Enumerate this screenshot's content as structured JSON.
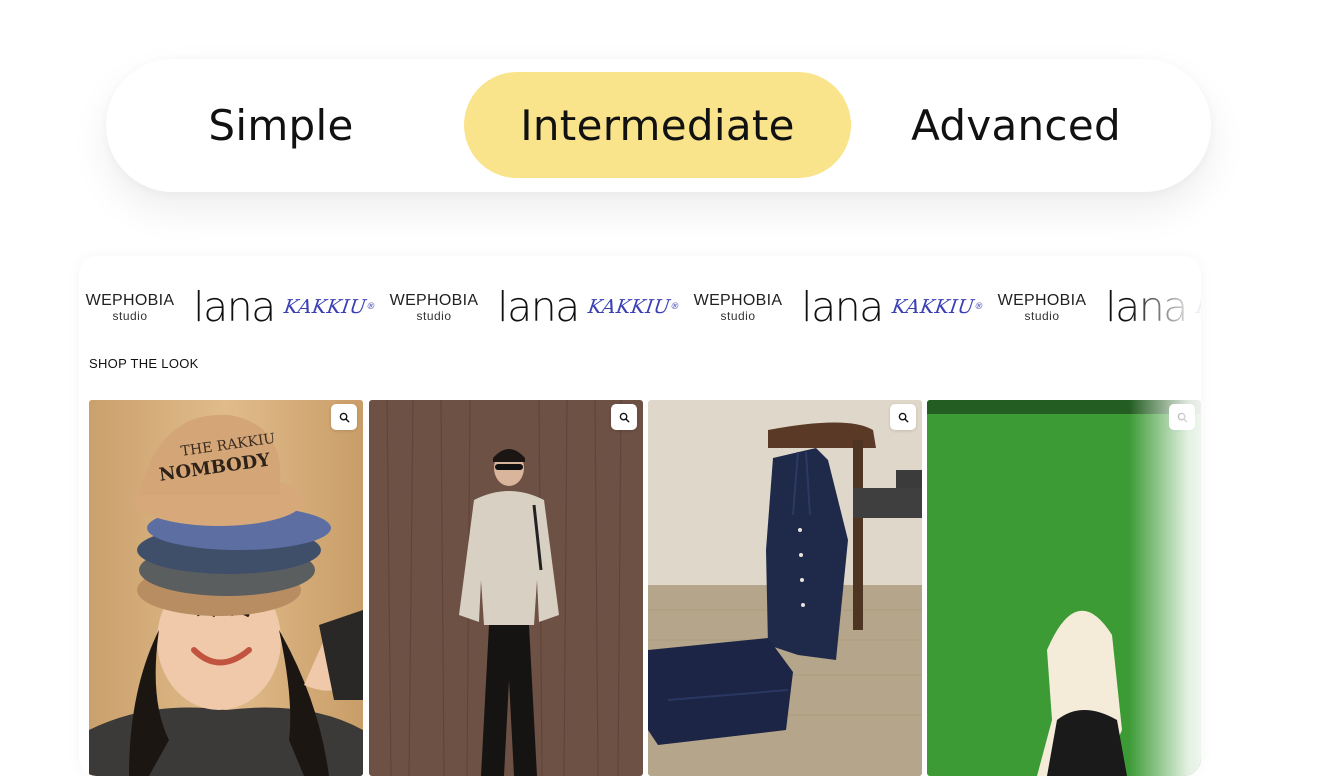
{
  "tabs": {
    "items": [
      {
        "label": "Simple",
        "active": false
      },
      {
        "label": "Intermediate",
        "active": true
      },
      {
        "label": "Advanced",
        "active": false
      }
    ],
    "active_color": "#f9e48c"
  },
  "brand_strip": {
    "wephobia": {
      "name": "WEPHOBIA",
      "sub": "studio"
    },
    "lana": "lana",
    "kakkiu": {
      "name": "KAKKIU",
      "mark": "®",
      "color": "#3a3fb4"
    },
    "sequence": [
      "wephobia",
      "lana",
      "kakkiu",
      "wephobia",
      "lana",
      "kakkiu",
      "wephobia",
      "lana",
      "kakkiu",
      "wephobia",
      "lana",
      "kakkiu"
    ]
  },
  "shop": {
    "title": "SHOP THE LOOK",
    "products": [
      {
        "name": "stacked-caps-look",
        "icon": "zoom-icon",
        "bg": "#d9b17e"
      },
      {
        "name": "beige-shirt-look",
        "icon": "zoom-icon",
        "bg": "#6f5347"
      },
      {
        "name": "navy-pajama-set-look",
        "icon": "zoom-icon",
        "bg": "#d9d2c4"
      },
      {
        "name": "green-studio-look",
        "icon": "zoom-icon",
        "bg": "#3e9a37"
      }
    ]
  }
}
